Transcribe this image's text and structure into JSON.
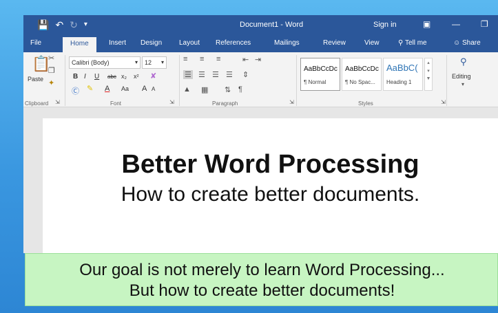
{
  "colors": {
    "brand": "#2b579a",
    "banner": "#c7f5c2",
    "background": "#3a97e0"
  },
  "titlebar": {
    "title": "Document1 - Word",
    "sign_in": "Sign in",
    "icons": [
      "save-icon",
      "undo-icon",
      "redo-icon",
      "customize-qat-icon",
      "ribbon-display-icon",
      "minimize-icon",
      "restore-icon"
    ]
  },
  "tabs": {
    "file": "File",
    "home": "Home",
    "insert": "Insert",
    "design": "Design",
    "layout": "Layout",
    "references": "References",
    "mailings": "Mailings",
    "review": "Review",
    "view": "View",
    "tell_me": "Tell me",
    "share": "Share"
  },
  "ribbon": {
    "clipboard": {
      "label": "Clipboard",
      "paste": "Paste"
    },
    "font": {
      "label": "Font",
      "name": "Calibri (Body)",
      "size": "12",
      "bold": "B",
      "italic": "I",
      "underline": "U",
      "strikethrough": "abc",
      "subscript": "x₂",
      "superscript": "x²",
      "change_case": "Aa",
      "grow": "A",
      "shrink": "A",
      "font_color": "A"
    },
    "paragraph": {
      "label": "Paragraph"
    },
    "styles": {
      "label": "Styles",
      "items": [
        {
          "preview": "AaBbCcDc",
          "name": "¶ Normal"
        },
        {
          "preview": "AaBbCcDc",
          "name": "¶ No Spac..."
        },
        {
          "preview": "AaBbC(",
          "name": "Heading 1"
        }
      ]
    },
    "editing": {
      "label": "Editing"
    }
  },
  "document": {
    "title": "Better Word Processing",
    "subtitle": "How to create better documents."
  },
  "banner": {
    "line1": "Our goal is not merely to learn Word Processing...",
    "line2": "But how to create better documents!"
  }
}
